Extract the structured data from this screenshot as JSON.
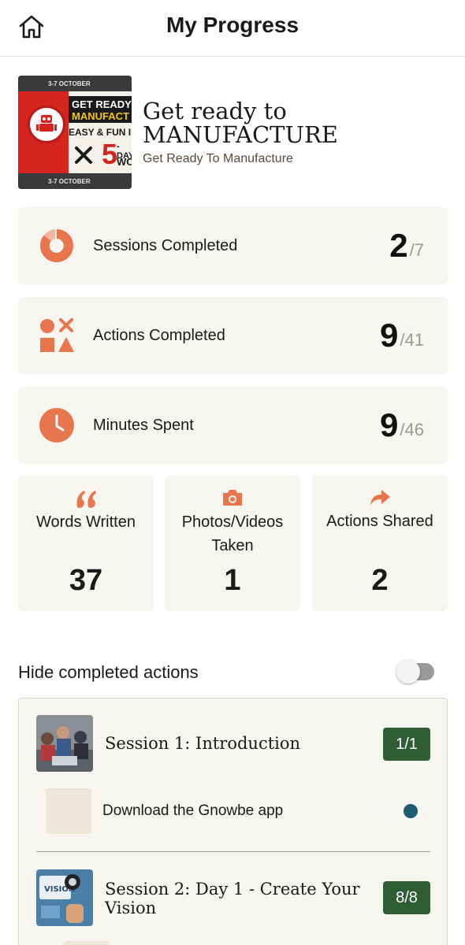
{
  "header": {
    "title": "My Progress",
    "home_icon": "home-icon"
  },
  "course": {
    "title": "Get ready to MANUFACTURE",
    "subtitle": "Get Ready To Manufacture",
    "cover": {
      "date_top": "3-7 OCTOBER",
      "date_bottom": "3-7 OCTOBER",
      "line1": "GET READY",
      "line2": "MANUFACT",
      "line3": "EASY & FUN INTE",
      "big_number": "5",
      "day_text": "-DAY",
      "wo_text": "WO"
    }
  },
  "stats": [
    {
      "label": "Sessions Completed",
      "value": "2",
      "total": "/7",
      "icon": "donut-progress-icon"
    },
    {
      "label": "Actions Completed",
      "value": "9",
      "total": "/41",
      "icon": "shapes-icon"
    },
    {
      "label": "Minutes Spent",
      "value": "9",
      "total": "/46",
      "icon": "clock-icon"
    }
  ],
  "tiles": [
    {
      "label": "Words Written",
      "value": "37",
      "icon": "quote-icon"
    },
    {
      "label": "Photos/Videos Taken",
      "value": "1",
      "icon": "camera-icon"
    },
    {
      "label": "Actions Shared",
      "value": "2",
      "icon": "share-arrow-icon"
    }
  ],
  "hide_completed": {
    "label": "Hide completed actions",
    "enabled": false
  },
  "sessions": [
    {
      "title": "Session 1: Introduction",
      "count": "1/1",
      "actions": [
        {
          "label": "Download the Gnowbe app"
        }
      ]
    },
    {
      "title": "Session 2: Day 1 - Create Your Vision",
      "count": "8/8"
    }
  ],
  "colors": {
    "accent": "#e8764c",
    "card_bg": "#f7f5f0",
    "badge_green": "#2f5e34",
    "dot_blue": "#1f5a6e"
  }
}
